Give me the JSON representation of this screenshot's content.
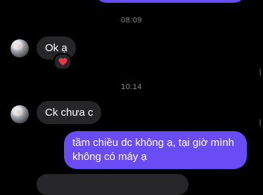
{
  "messages": [
    {
      "kind": "timestamp",
      "text": "08:09"
    },
    {
      "kind": "incoming",
      "text": "Ok ạ",
      "reaction": "heart-icon"
    },
    {
      "kind": "timestamp",
      "text": "10:14"
    },
    {
      "kind": "incoming",
      "text": "Ck chưa c"
    },
    {
      "kind": "outgoing",
      "text": "tầm chiều dc không ạ, tại giờ mình không có máy ạ"
    }
  ],
  "colors": {
    "background": "#000000",
    "outgoing_bubble": "#6a4cf5",
    "incoming_bubble": "#262628",
    "timestamp": "#8e8e93",
    "reaction_heart": "#e8384f"
  }
}
